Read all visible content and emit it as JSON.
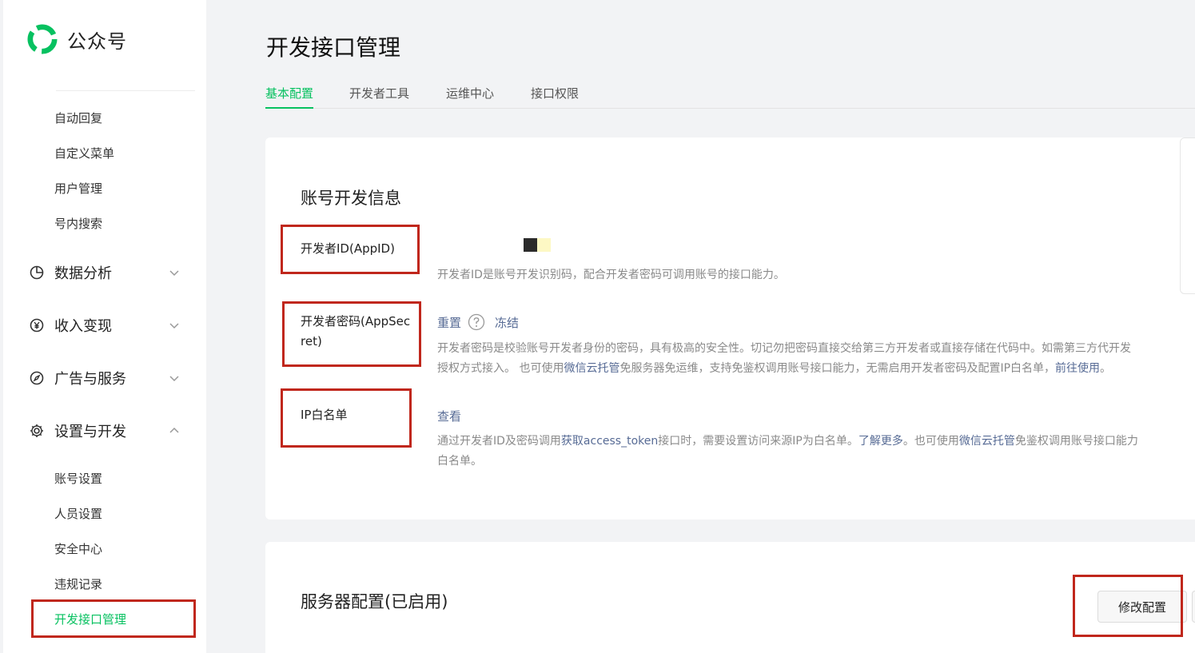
{
  "brand": {
    "name": "公众号",
    "color": "#07c160"
  },
  "sidebar": {
    "top_items": [
      "自动回复",
      "自定义菜单",
      "用户管理",
      "号内搜索"
    ],
    "groups": [
      {
        "label": "数据分析",
        "icon": "pie-chart-icon",
        "expanded": false
      },
      {
        "label": "收入变现",
        "icon": "yen-icon",
        "expanded": false
      },
      {
        "label": "广告与服务",
        "icon": "compass-icon",
        "expanded": false
      },
      {
        "label": "设置与开发",
        "icon": "gear-icon",
        "expanded": true
      }
    ],
    "settings_items": [
      "账号设置",
      "人员设置",
      "安全中心",
      "违规记录",
      "开发接口管理"
    ],
    "active_item": "开发接口管理"
  },
  "page": {
    "title": "开发接口管理"
  },
  "tabs": [
    "基本配置",
    "开发者工具",
    "运维中心",
    "接口权限"
  ],
  "active_tab": "基本配置",
  "dev_info": {
    "title": "账号开发信息",
    "appid": {
      "label": "开发者ID(AppID)",
      "desc": "开发者ID是账号开发识别码，配合开发者密码可调用账号的接口能力。"
    },
    "appsecret": {
      "label_line1": "开发者密码(AppSec",
      "label_line2": "ret)",
      "reset": "重置",
      "freeze": "冻结",
      "desc1": "开发者密码是校验账号开发者身份的密码，具有极高的安全性。切记勿把密码直接交给第三方开发者或直接存储在代码中。如需第三方代开发",
      "desc2_a": "授权方式接入。 也可使用",
      "desc2_link1": "微信云托管",
      "desc2_b": "免服务器免运维，支持免鉴权调用账号接口能力，无需启用开发者密码及配置IP白名单，",
      "desc2_link2": "前往使用",
      "desc2_c": "。"
    },
    "ip_whitelist": {
      "label": "IP白名单",
      "view": "查看",
      "desc1_a": "通过开发者ID及密码调用",
      "desc1_link1": "获取access_token",
      "desc1_b": "接口时，需要设置访问来源IP为白名单。",
      "desc1_link2": "了解更多",
      "desc1_c": "。也可使用",
      "desc1_link3": "微信云托管",
      "desc1_d": "免鉴权调用账号接口能力",
      "desc2": "白名单。"
    }
  },
  "server_config": {
    "title": "服务器配置(已启用)",
    "modify_button": "修改配置"
  },
  "colors": {
    "accent": "#07c160",
    "link": "#576b95",
    "highlight_box": "#c0271c"
  }
}
